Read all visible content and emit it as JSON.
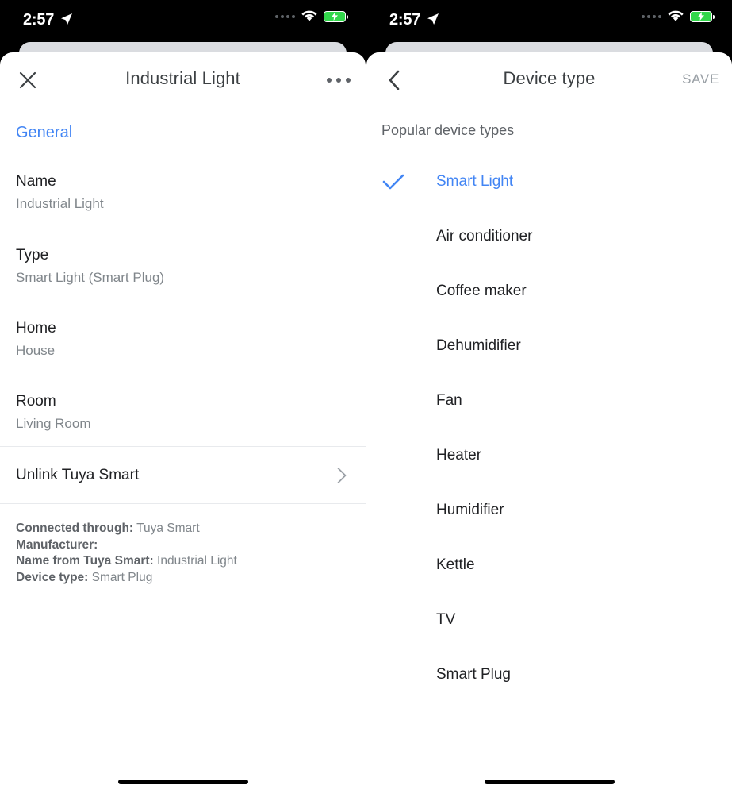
{
  "status_bar": {
    "time": "2:57",
    "location_icon": "location-arrow-icon",
    "signal_icon": "signal-dots-icon",
    "wifi_icon": "wifi-icon",
    "battery_icon": "battery-charging-icon"
  },
  "left_panel": {
    "appbar": {
      "close_icon": "close-icon",
      "title": "Industrial Light",
      "overflow_icon": "more-options-icon"
    },
    "section_header": "General",
    "fields": [
      {
        "label": "Name",
        "value": "Industrial Light"
      },
      {
        "label": "Type",
        "value": "Smart Light (Smart Plug)"
      },
      {
        "label": "Home",
        "value": "House"
      },
      {
        "label": "Room",
        "value": "Living Room"
      }
    ],
    "unlink_row": {
      "label": "Unlink Tuya Smart",
      "chevron_icon": "chevron-right-icon"
    },
    "metadata": [
      {
        "label": "Connected through:",
        "value": "Tuya Smart"
      },
      {
        "label": "Manufacturer:",
        "value": ""
      },
      {
        "label": "Name from Tuya Smart:",
        "value": "Industrial Light"
      },
      {
        "label": "Device type:",
        "value": "Smart Plug"
      }
    ]
  },
  "right_panel": {
    "appbar": {
      "back_icon": "back-arrow-icon",
      "title": "Device type",
      "save_label": "SAVE"
    },
    "subheader": "Popular device types",
    "selected_device_type": "Smart Light",
    "check_icon": "check-icon",
    "device_types": [
      {
        "label": "Smart Light",
        "selected": true
      },
      {
        "label": "Air conditioner",
        "selected": false
      },
      {
        "label": "Coffee maker",
        "selected": false
      },
      {
        "label": "Dehumidifier",
        "selected": false
      },
      {
        "label": "Fan",
        "selected": false
      },
      {
        "label": "Heater",
        "selected": false
      },
      {
        "label": "Humidifier",
        "selected": false
      },
      {
        "label": "Kettle",
        "selected": false
      },
      {
        "label": "TV",
        "selected": false
      },
      {
        "label": "Smart Plug",
        "selected": false
      }
    ]
  },
  "colors": {
    "accent_blue": "#4285f4",
    "primary_text": "#202124",
    "secondary_text": "#80868b",
    "disabled_text": "#9aa0a6",
    "battery_green": "#32d74b",
    "divider": "#e8eaed"
  }
}
